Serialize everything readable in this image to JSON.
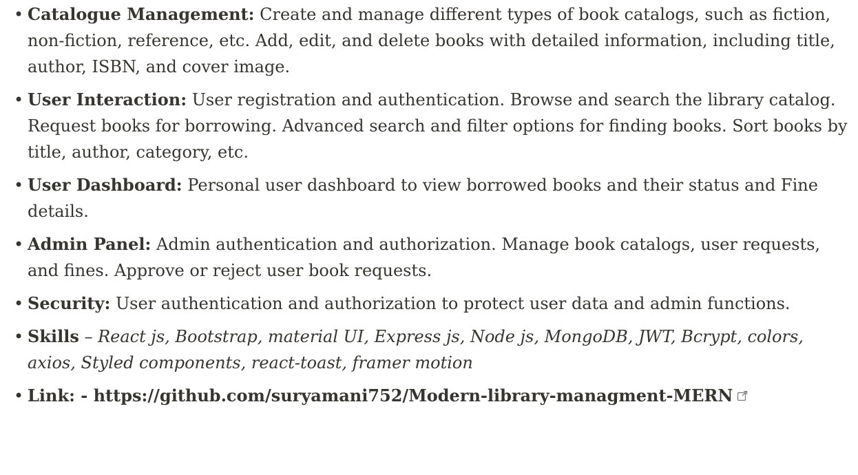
{
  "features": [
    {
      "label": "Catalogue Management:",
      "text": " Create and manage different types of book catalogs, such as fiction, non-fiction, reference, etc. Add, edit, and delete books with detailed information, including title, author, ISBN, and cover image."
    },
    {
      "label": "User Interaction:",
      "text": " User registration and authentication. Browse and search the library catalog. Request books for borrowing. Advanced search and filter options for finding books. Sort books by title, author, category, etc."
    },
    {
      "label": "User Dashboard:",
      "text": " Personal user dashboard to view borrowed books and their status and Fine details."
    },
    {
      "label": "Admin Panel:",
      "text": " Admin authentication and authorization. Manage book catalogs, user requests, and fines. Approve or reject user book requests."
    },
    {
      "label": "Security:",
      "text": " User authentication and authorization to protect user data and admin functions."
    }
  ],
  "skills": {
    "label": "Skills",
    "dash": " – ",
    "list": "React js, Bootstrap, material UI, Express js, Node js, MongoDB, JWT, Bcrypt, colors, axios, Styled components, react-toast, framer motion"
  },
  "link": {
    "label": "Link: - ",
    "url": "https://github.com/suryamani752/Modern-library-managment-MERN",
    "icon": "external-link-icon"
  },
  "bullet_glyph": "•"
}
